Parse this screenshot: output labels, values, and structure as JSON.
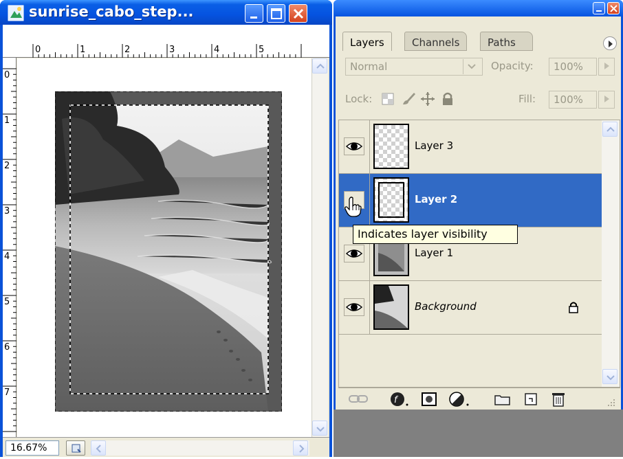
{
  "document": {
    "title": "sunrise_cabo_step...",
    "zoom": "16.67%",
    "ruler_top_labels": [
      "0",
      "1",
      "2",
      "3",
      "4",
      "5"
    ],
    "ruler_left_labels": [
      "0",
      "1",
      "2",
      "3",
      "4",
      "5",
      "6",
      "7"
    ]
  },
  "layers_palette": {
    "tabs": [
      "Layers",
      "Channels",
      "Paths"
    ],
    "blend_mode": "Normal",
    "opacity_label": "Opacity:",
    "opacity_value": "100%",
    "lock_label": "Lock:",
    "fill_label": "Fill:",
    "fill_value": "100%",
    "layers": [
      {
        "name": "Layer 3",
        "visible": true,
        "selected": false
      },
      {
        "name": "Layer 2",
        "visible": false,
        "selected": true
      },
      {
        "name": "Layer 1",
        "visible": true,
        "selected": false
      },
      {
        "name": "Background",
        "visible": true,
        "selected": false,
        "locked": true
      }
    ]
  },
  "tooltip": "Indicates layer visibility",
  "colors": {
    "titlebar_blue": "#0553e0",
    "selection_blue": "#316ac5",
    "panel_bg": "#ece9d8",
    "tooltip_bg": "#ffffe1"
  }
}
